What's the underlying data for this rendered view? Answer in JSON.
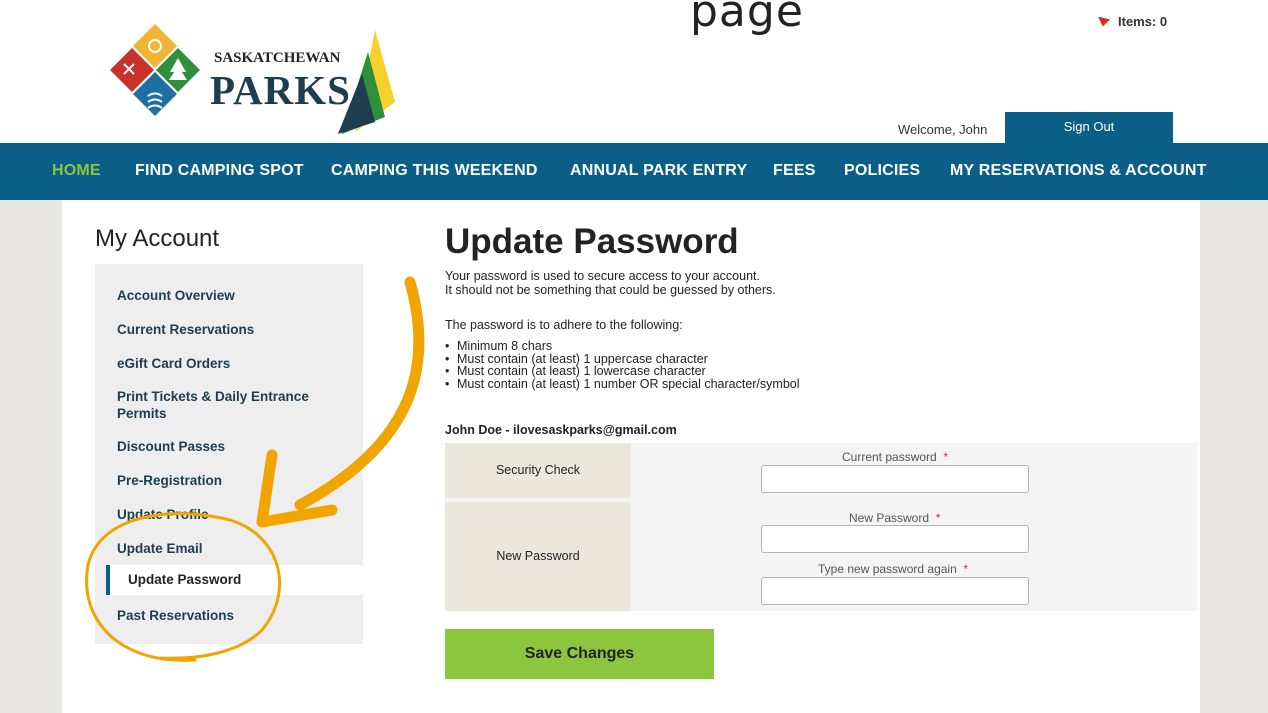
{
  "header": {
    "caption_fragment": "page",
    "cart_label": "Items: 0",
    "brand_small": "SASKATCHEWAN",
    "brand_big": "PARKS",
    "welcome": "Welcome, John",
    "sign_out": "Sign Out"
  },
  "nav": {
    "items": [
      {
        "label": "HOME",
        "active": true
      },
      {
        "label": "FIND CAMPING SPOT"
      },
      {
        "label": "CAMPING THIS WEEKEND"
      },
      {
        "label": "ANNUAL PARK ENTRY"
      },
      {
        "label": "FEES"
      },
      {
        "label": "POLICIES"
      },
      {
        "label": "MY RESERVATIONS & ACCOUNT"
      }
    ]
  },
  "sidebar": {
    "title": "My Account",
    "items": [
      {
        "label": "Account Overview"
      },
      {
        "label": "Current Reservations"
      },
      {
        "label": "eGift Card Orders"
      },
      {
        "label": "Print Tickets & Daily Entrance Permits"
      },
      {
        "label": "Discount Passes"
      },
      {
        "label": "Pre-Registration"
      },
      {
        "label": "Update Profile"
      },
      {
        "label": "Update Email"
      },
      {
        "label": "Update Password",
        "active": true
      },
      {
        "label": "Past Reservations"
      }
    ]
  },
  "main": {
    "title": "Update Password",
    "intro_line1": "Your password is used to secure access to your account.",
    "intro_line2": "It should not be something that could be guessed by others.",
    "rules_intro": "The password is to adhere to the following:",
    "rules": [
      "Minimum 8 chars",
      "Must contain (at least) 1 uppercase character",
      "Must contain (at least) 1 lowercase character",
      "Must contain (at least) 1 number OR special character/symbol"
    ],
    "user_line": "John Doe - ilovesaskparks@gmail.com",
    "security_check_label": "Security Check",
    "current_password_label": "Current password",
    "new_password_section_label": "New Password",
    "new_password_label": "New Password",
    "confirm_password_label": "Type new password again",
    "required_mark": "*",
    "save_button": "Save Changes"
  },
  "colors": {
    "nav_blue": "#0b5f86",
    "accent_green": "#8cc63f",
    "annotation_orange": "#f0a500",
    "required_red": "#d52b2b"
  }
}
